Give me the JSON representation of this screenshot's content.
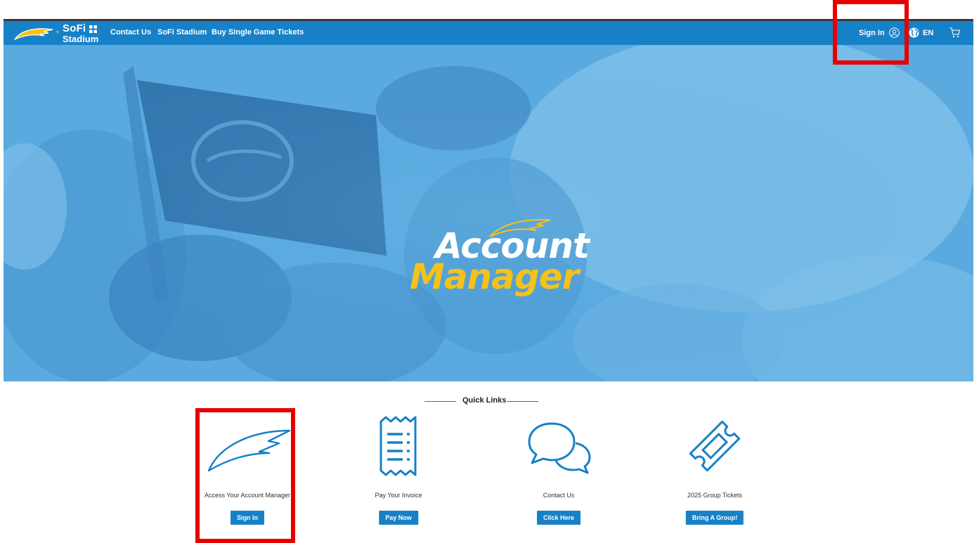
{
  "nav": {
    "brand_line1": "SoFi",
    "brand_line2": "Stadium",
    "links": [
      "Contact Us",
      "SoFi Stadium",
      "Buy Single Game Tickets"
    ],
    "sign_in_label": "Sign In",
    "language_label": "EN"
  },
  "hero": {
    "title_line1": "Account",
    "title_line2": "Manager"
  },
  "quick_links": {
    "heading": "Quick Links",
    "items": [
      {
        "label": "Access Your Account Manager",
        "button": "Sign In",
        "icon": "bolt-icon"
      },
      {
        "label": "Pay Your Invoice",
        "button": "Pay Now",
        "icon": "receipt-icon"
      },
      {
        "label": "Contact Us",
        "button": "Click Here",
        "icon": "chat-bubbles-icon"
      },
      {
        "label": "2025 Group Tickets",
        "button": "Bring A Group!",
        "icon": "ticket-icon"
      }
    ]
  },
  "colors": {
    "nav_blue": "#1781c7",
    "hero_blue": "#58a9df",
    "accent_gold": "#f5c11a",
    "highlight_red": "#e60000"
  }
}
